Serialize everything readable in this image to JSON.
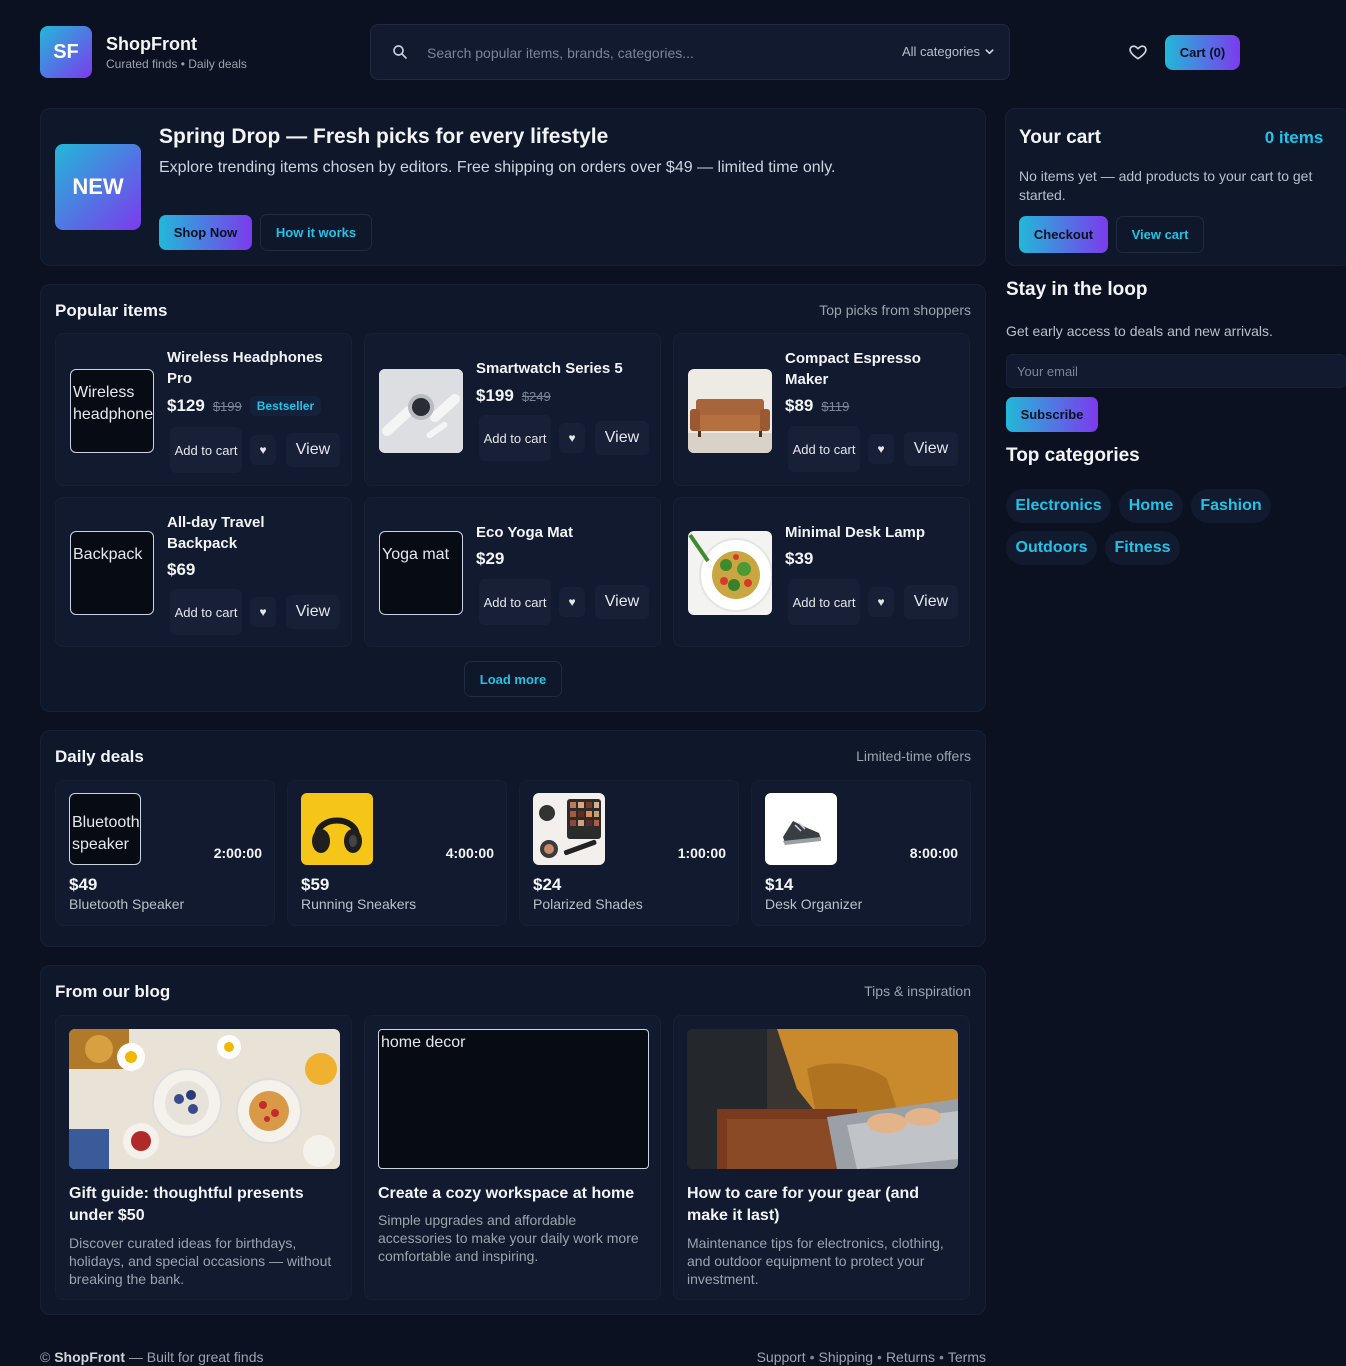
{
  "header": {
    "logo_text": "SF",
    "brand_name": "ShopFront",
    "tagline": "Curated finds • Daily deals",
    "search_placeholder": "Search popular items, brands, categories...",
    "category_select": "All categories",
    "cart_button": "Cart (0)"
  },
  "hero": {
    "badge": "NEW",
    "title": "Spring Drop — Fresh picks for every lifestyle",
    "description": "Explore trending items chosen by editors. Free shipping on orders over $49 — limited time only.",
    "primary_button": "Shop Now",
    "secondary_button": "How it works"
  },
  "popular": {
    "title": "Popular items",
    "subtitle": "Top picks from shoppers",
    "add_to_cart_label": "Add to cart",
    "heart_glyph": "♥",
    "view_label": "View",
    "load_more": "Load more",
    "items": [
      {
        "name": "Wireless Headphones Pro",
        "price": "$129",
        "old_price": "$199",
        "badge": "Bestseller",
        "img_alt": "Wireless headphones"
      },
      {
        "name": "Smartwatch Series 5",
        "price": "$199",
        "old_price": "$249",
        "badge": "",
        "img_alt": ""
      },
      {
        "name": "Compact Espresso Maker",
        "price": "$89",
        "old_price": "$119",
        "badge": "",
        "img_alt": ""
      },
      {
        "name": "All-day Travel Backpack",
        "price": "$69",
        "old_price": "",
        "badge": "",
        "img_alt": "Backpack"
      },
      {
        "name": "Eco Yoga Mat",
        "price": "$29",
        "old_price": "",
        "badge": "",
        "img_alt": "Yoga mat"
      },
      {
        "name": "Minimal Desk Lamp",
        "price": "$39",
        "old_price": "",
        "badge": "",
        "img_alt": ""
      }
    ]
  },
  "deals": {
    "title": "Daily deals",
    "subtitle": "Limited-time offers",
    "items": [
      {
        "img_alt": "Bluetooth speaker",
        "timer": "2:00:00",
        "price": "$49",
        "name": "Bluetooth Speaker"
      },
      {
        "img_alt": "",
        "timer": "4:00:00",
        "price": "$59",
        "name": "Running Sneakers"
      },
      {
        "img_alt": "",
        "timer": "1:00:00",
        "price": "$24",
        "name": "Polarized Shades"
      },
      {
        "img_alt": "",
        "timer": "8:00:00",
        "price": "$14",
        "name": "Desk Organizer"
      }
    ]
  },
  "blog": {
    "title": "From our blog",
    "subtitle": "Tips & inspiration",
    "posts": [
      {
        "img_alt": "",
        "title": "Gift guide: thoughtful presents under $50",
        "excerpt": "Discover curated ideas for birthdays, holidays, and special occasions — without breaking the bank."
      },
      {
        "img_alt": "home decor",
        "title": "Create a cozy workspace at home",
        "excerpt": "Simple upgrades and affordable accessories to make your daily work more comfortable and inspiring."
      },
      {
        "img_alt": "",
        "title": "How to care for your gear (and make it last)",
        "excerpt": "Maintenance tips for electronics, clothing, and outdoor equipment to protect your investment."
      }
    ]
  },
  "sidebar": {
    "cart": {
      "title": "Your cart",
      "count": "0 items",
      "empty_text": "No items yet — add products to your cart to get started.",
      "checkout": "Checkout",
      "view_cart": "View cart"
    },
    "newsletter": {
      "title": "Stay in the loop",
      "text": "Get early access to deals and new arrivals.",
      "email_placeholder": "Your email",
      "subscribe": "Subscribe"
    },
    "categories": {
      "title": "Top categories",
      "items": [
        "Electronics",
        "Home",
        "Fashion",
        "Outdoors",
        "Fitness"
      ]
    }
  },
  "footer": {
    "copyright": "©",
    "brand": "ShopFront",
    "suffix": "— Built for great finds",
    "links": [
      "Support",
      "Shipping",
      "Returns",
      "Terms"
    ],
    "separator": "•"
  },
  "colors": {
    "background": "#0b1120",
    "panel": "#0f172a",
    "card": "#111a2e",
    "accent_cyan": "#22c3e6",
    "accent_purple": "#7c3aed"
  }
}
